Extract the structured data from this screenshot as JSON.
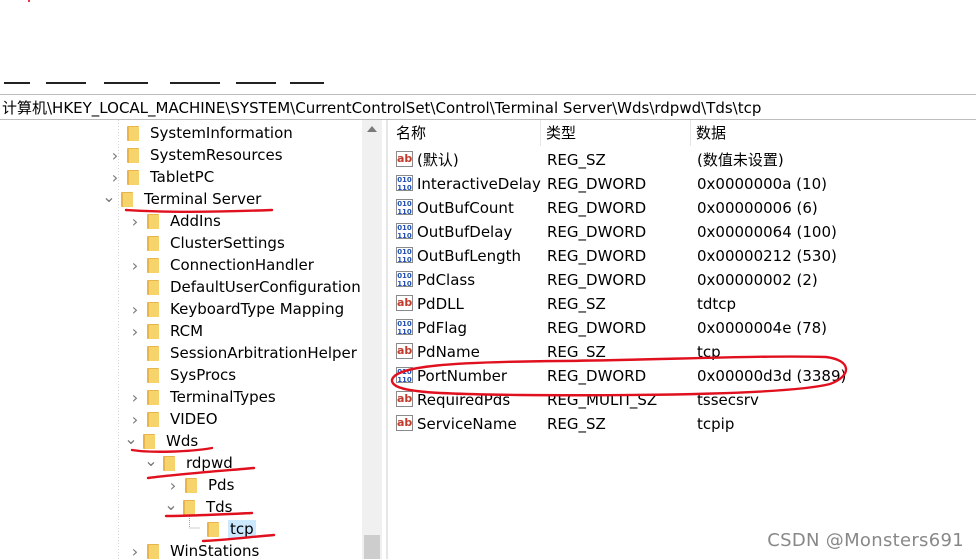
{
  "address_bar": {
    "path": "计算机\\HKEY_LOCAL_MACHINE\\SYSTEM\\CurrentControlSet\\Control\\Terminal Server\\Wds\\rdpwd\\Tds\\tcp"
  },
  "tree": {
    "items": [
      {
        "label": "SystemInformation",
        "expander": "none"
      },
      {
        "label": "SystemResources",
        "expander": "collapsed"
      },
      {
        "label": "TabletPC",
        "expander": "collapsed"
      },
      {
        "label": "Terminal Server",
        "expander": "expanded"
      },
      {
        "label": "AddIns",
        "expander": "collapsed"
      },
      {
        "label": "ClusterSettings",
        "expander": "none"
      },
      {
        "label": "ConnectionHandler",
        "expander": "collapsed"
      },
      {
        "label": "DefaultUserConfiguration",
        "expander": "none"
      },
      {
        "label": "KeyboardType Mapping",
        "expander": "collapsed"
      },
      {
        "label": "RCM",
        "expander": "collapsed"
      },
      {
        "label": "SessionArbitrationHelper",
        "expander": "none"
      },
      {
        "label": "SysProcs",
        "expander": "none"
      },
      {
        "label": "TerminalTypes",
        "expander": "collapsed"
      },
      {
        "label": "VIDEO",
        "expander": "collapsed"
      },
      {
        "label": "Wds",
        "expander": "expanded"
      },
      {
        "label": "rdpwd",
        "expander": "expanded"
      },
      {
        "label": "Pds",
        "expander": "collapsed"
      },
      {
        "label": "Tds",
        "expander": "expanded"
      },
      {
        "label": "tcp",
        "expander": "none",
        "selected": true
      },
      {
        "label": "WinStations",
        "expander": "collapsed"
      }
    ]
  },
  "list": {
    "headers": {
      "name": "名称",
      "type": "类型",
      "data": "数据"
    },
    "rows": [
      {
        "icon": "string-value-icon",
        "name": "(默认)",
        "type": "REG_SZ",
        "data": "(数值未设置)"
      },
      {
        "icon": "binary-value-icon",
        "name": "InteractiveDelay",
        "type": "REG_DWORD",
        "data": "0x0000000a (10)"
      },
      {
        "icon": "binary-value-icon",
        "name": "OutBufCount",
        "type": "REG_DWORD",
        "data": "0x00000006 (6)"
      },
      {
        "icon": "binary-value-icon",
        "name": "OutBufDelay",
        "type": "REG_DWORD",
        "data": "0x00000064 (100)"
      },
      {
        "icon": "binary-value-icon",
        "name": "OutBufLength",
        "type": "REG_DWORD",
        "data": "0x00000212 (530)"
      },
      {
        "icon": "binary-value-icon",
        "name": "PdClass",
        "type": "REG_DWORD",
        "data": "0x00000002 (2)"
      },
      {
        "icon": "string-value-icon",
        "name": "PdDLL",
        "type": "REG_SZ",
        "data": "tdtcp"
      },
      {
        "icon": "binary-value-icon",
        "name": "PdFlag",
        "type": "REG_DWORD",
        "data": "0x0000004e (78)"
      },
      {
        "icon": "string-value-icon",
        "name": "PdName",
        "type": "REG_SZ",
        "data": "tcp"
      },
      {
        "icon": "binary-value-icon",
        "name": "PortNumber",
        "type": "REG_DWORD",
        "data": "0x00000d3d (3389)"
      },
      {
        "icon": "string-value-icon",
        "name": "RequiredPds",
        "type": "REG_MULTI_SZ",
        "data": "tssecsrv"
      },
      {
        "icon": "string-value-icon",
        "name": "ServiceName",
        "type": "REG_SZ",
        "data": "tcpip"
      }
    ]
  },
  "watermark": "CSDN @Monsters691",
  "colors": {
    "annotation": "#e0101e",
    "selection": "#cce8ff",
    "folder": "#f6d36b"
  }
}
